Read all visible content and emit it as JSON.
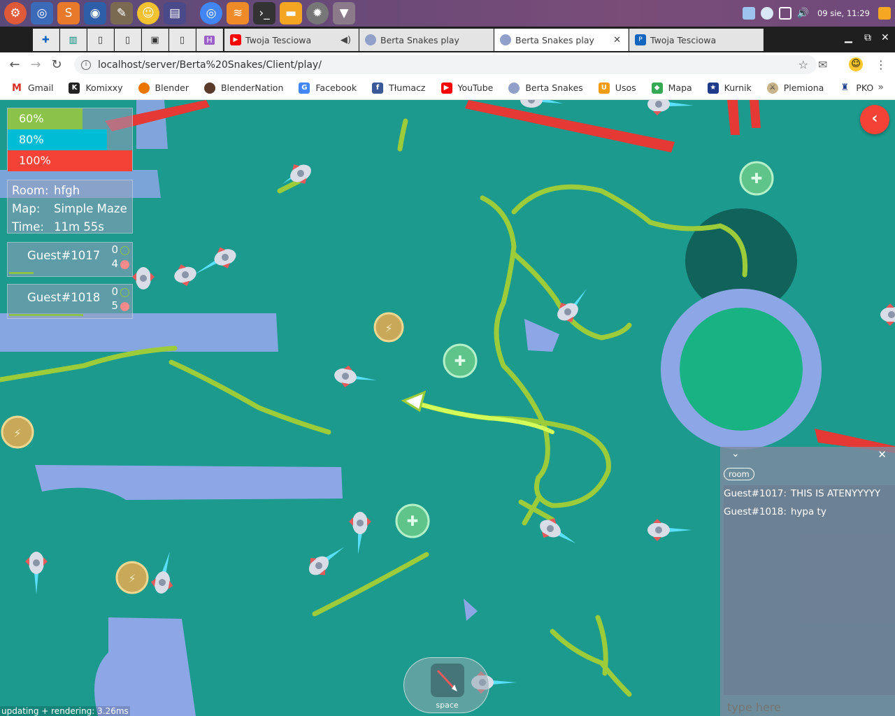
{
  "taskbar": {
    "clock": "09 sie, 11:29",
    "apps": [
      "menu-icon",
      "chromium-icon",
      "sublime-icon",
      "blender-icon",
      "gimp-icon",
      "smiley-icon",
      "files-icon",
      "chrome-icon",
      "sublime-text-icon",
      "terminal-icon",
      "folder-icon",
      "settings-icon",
      "cat-icon"
    ]
  },
  "tabs": [
    {
      "title": "Twoja Tesciowa",
      "active": false
    },
    {
      "title": "Berta Snakes play",
      "active": false
    },
    {
      "title": "Berta Snakes play",
      "active": true
    },
    {
      "title": "Twoja Tesciowa",
      "active": false
    }
  ],
  "address": {
    "url": "localhost/server/Berta%20Snakes/Client/play/"
  },
  "bookmarks": [
    "Gmail",
    "Komixxy",
    "Blender",
    "BlenderNation",
    "Facebook",
    "Tłumacz",
    "YouTube",
    "Berta Snakes",
    "Usos",
    "Mapa",
    "Kurnik",
    "Plemiona",
    "PKO"
  ],
  "hud": {
    "power_levels": [
      {
        "label": "60%",
        "color": "#8bc34a",
        "fill": 0.6
      },
      {
        "label": "80%",
        "color": "#00bcd4",
        "fill": 0.8
      },
      {
        "label": "100%",
        "color": "#f44336",
        "fill": 1.0
      }
    ],
    "room_label": "Room:",
    "room": "hfgh",
    "map_label": "Map:",
    "map": "Simple Maze",
    "time_label": "Time:",
    "time": "11m 55s",
    "players": [
      {
        "name": "Guest#1017",
        "kills": "0",
        "deaths": "4",
        "bar": 0.2
      },
      {
        "name": "Guest#1018",
        "kills": "0",
        "deaths": "5",
        "bar": 0.6
      }
    ]
  },
  "chat": {
    "tab": "room",
    "messages": [
      {
        "from": "Guest#1017:",
        "text": "THIS IS ATENYYYYY"
      },
      {
        "from": "Guest#1018:",
        "text": "hypa ty"
      }
    ],
    "placeholder": "type here"
  },
  "perf": "updating + rendering: 3.26ms",
  "space_label": "space",
  "colors": {
    "accent": "#f44336",
    "background": "#1b9a8d",
    "wall": "#8ca6e6",
    "snake": "#9ccc3a"
  }
}
